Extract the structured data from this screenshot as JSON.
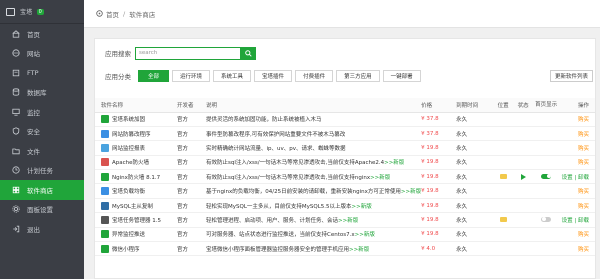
{
  "sidebar": {
    "host": "宝塔",
    "badge": "0",
    "items": [
      {
        "label": "首页",
        "icon": "home-icon"
      },
      {
        "label": "网站",
        "icon": "globe-icon"
      },
      {
        "label": "FTP",
        "icon": "ftp-icon"
      },
      {
        "label": "数据库",
        "icon": "database-icon"
      },
      {
        "label": "监控",
        "icon": "monitor-icon"
      },
      {
        "label": "安全",
        "icon": "shield-icon"
      },
      {
        "label": "文件",
        "icon": "folder-icon"
      },
      {
        "label": "计划任务",
        "icon": "clock-icon"
      },
      {
        "label": "软件商店",
        "icon": "store-icon",
        "active": true
      },
      {
        "label": "面板设置",
        "icon": "gear-icon"
      },
      {
        "label": "退出",
        "icon": "logout-icon"
      }
    ]
  },
  "breadcrumb": {
    "home": "首页",
    "sep": "/",
    "current": "软件商店"
  },
  "search": {
    "label": "应用搜索",
    "placeholder": "search"
  },
  "category": {
    "label": "应用分类",
    "items": [
      "全部",
      "运行环境",
      "系统工具",
      "宝塔插件",
      "付费插件",
      "第三方应用",
      "一键部署"
    ]
  },
  "update_button": "更新软件列表",
  "table": {
    "headers": {
      "name": "软件名称",
      "developer": "开发者",
      "description": "说明",
      "price": "价格",
      "expire": "到期时间",
      "position": "位置",
      "status": "状态",
      "homepage": "首页显示",
      "operation": "操作"
    },
    "rows": [
      {
        "name": "宝塔系统加固",
        "dev": "官方",
        "desc": "提供灵活的系统加固功能，防止系统被植入木马",
        "new": "",
        "price": "¥ 37.8",
        "expire": "永久",
        "folder": false,
        "status": "",
        "home": "",
        "op": "购买",
        "icon_color": "#20a53a"
      },
      {
        "name": "网站防篡改程序",
        "dev": "官方",
        "desc": "事件型防篡改程序,可有效保护网站重要文件不被木马篡改",
        "new": "",
        "price": "¥ 37.8",
        "expire": "永久",
        "folder": false,
        "status": "",
        "home": "",
        "op": "购买",
        "icon_color": "#3b8fe3"
      },
      {
        "name": "网站监控报表",
        "dev": "官方",
        "desc": "实时精确统计网站流量、ip、uv、pv、请求、蜘蛛等数据",
        "new": "",
        "price": "¥ 19.8",
        "expire": "永久",
        "folder": false,
        "status": "",
        "home": "",
        "op": "购买",
        "icon_color": "#4aa3df"
      },
      {
        "name": "Apache防火墙",
        "dev": "官方",
        "desc": "有效防止sql注入/xss/一句话木马等常见渗透攻击,当前仅支持Apache2.4",
        "new": ">>新版",
        "price": "¥ 19.8",
        "expire": "永久",
        "folder": false,
        "status": "",
        "home": "",
        "op": "购买",
        "icon_color": "#d9534f"
      },
      {
        "name": "Nginx防火墙 8.1.7",
        "dev": "官方",
        "desc": "有效防止sql注入/xss/一句话木马等常见渗透攻击,当前仅支持nginx",
        "new": ">>新版",
        "price": "¥ 19.8",
        "expire": "永久",
        "folder": true,
        "status": "play",
        "home": "on",
        "op": "设置 | 卸载",
        "icon_color": "#20a53a"
      },
      {
        "name": "宝塔负载均衡",
        "dev": "官方",
        "desc": "基于nginx的负载均衡，04/25日前安装的请卸载，重新安装nginx方可正常使用",
        "new": ">>新版",
        "price": "¥ 19.8",
        "expire": "永久",
        "folder": false,
        "status": "",
        "home": "",
        "op": "购买",
        "icon_color": "#3b8fe3"
      },
      {
        "name": "MySQL主从复制",
        "dev": "官方",
        "desc": "轻松实现MySQL一主多从，目前仅支持MySQL5.5以上版本",
        "new": ">>新版",
        "price": "¥ 19.8",
        "expire": "永久",
        "folder": false,
        "status": "",
        "home": "",
        "op": "购买",
        "icon_color": "#2f6ea5"
      },
      {
        "name": "宝塔任务管理器 1.5",
        "dev": "官方",
        "desc": "轻松管理进程、启动项、用户、服务、计划任务、会话",
        "new": ">>新版",
        "price": "¥ 19.8",
        "expire": "永久",
        "folder": true,
        "status": "",
        "home": "off",
        "op": "设置 | 卸载",
        "icon_color": "#555"
      },
      {
        "name": "异常监控推送",
        "dev": "官方",
        "desc": "可对服务器、站点状态进行监控推送，当前仅支持Centos7.x",
        "new": ">>新版",
        "price": "¥ 19.8",
        "expire": "永久",
        "folder": false,
        "status": "",
        "home": "",
        "op": "购买",
        "icon_color": "#20a53a"
      },
      {
        "name": "微信小程序",
        "dev": "官方",
        "desc": "宝塔微信小程序面板管理器监控服务器安全的管理手机应用",
        "new": ">>新版",
        "price": "¥ 4.0",
        "expire": "永久",
        "folder": false,
        "status": "",
        "home": "",
        "op": "购买",
        "icon_color": "#20a53a"
      }
    ]
  },
  "colors": {
    "accent": "#20a53a",
    "sidebar": "#3b3e45",
    "price": "#f0484a"
  }
}
